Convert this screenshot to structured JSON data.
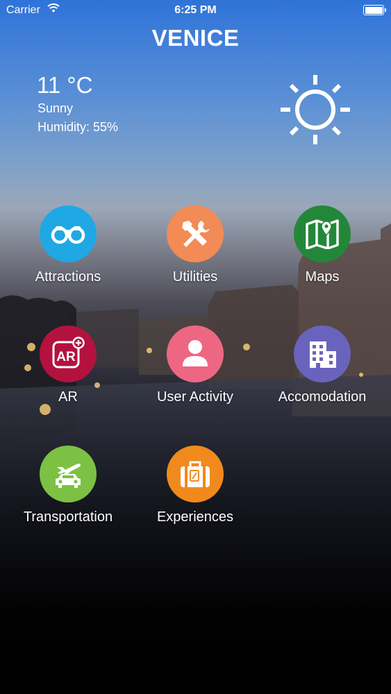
{
  "status_bar": {
    "carrier": "Carrier",
    "time": "6:25 PM"
  },
  "header": {
    "city": "VENICE"
  },
  "weather": {
    "temperature": "11 °C",
    "condition": "Sunny",
    "humidity": "Humidity: 55%",
    "icon": "sun-icon"
  },
  "menu": [
    {
      "label": "Attractions",
      "icon": "binoculars-icon",
      "color": "#1fa8e4"
    },
    {
      "label": "Utilities",
      "icon": "tools-icon",
      "color": "#f28b55"
    },
    {
      "label": "Maps",
      "icon": "map-icon",
      "color": "#23873a"
    },
    {
      "label": "AR",
      "icon": "ar-icon",
      "color": "#b4123e"
    },
    {
      "label": "User Activity",
      "icon": "user-icon",
      "color": "#ee6782"
    },
    {
      "label": "Accomodation",
      "icon": "building-icon",
      "color": "#6a63bd"
    },
    {
      "label": "Transportation",
      "icon": "plane-car-icon",
      "color": "#7cc143"
    },
    {
      "label": "Experiences",
      "icon": "suitcase-icon",
      "color": "#f08a1c"
    }
  ]
}
